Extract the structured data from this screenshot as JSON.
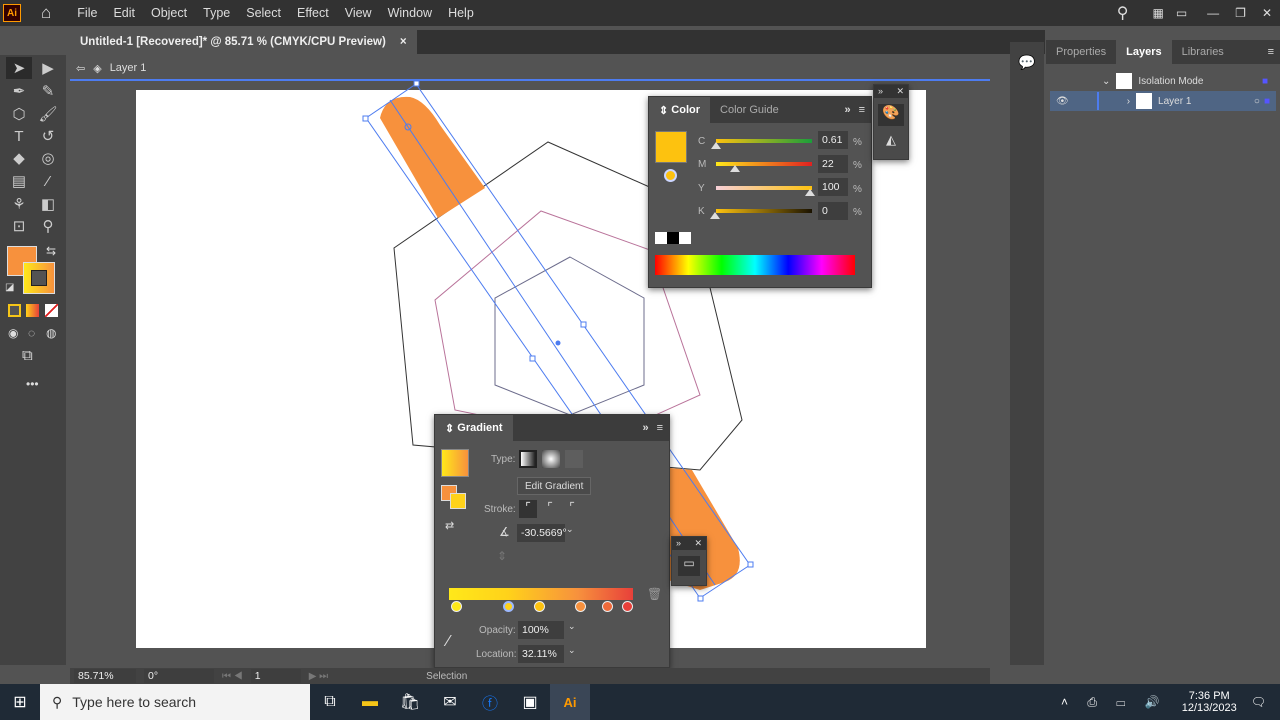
{
  "app": {
    "logo": "Ai",
    "menu": [
      "File",
      "Edit",
      "Object",
      "Type",
      "Select",
      "Effect",
      "View",
      "Window",
      "Help"
    ]
  },
  "document": {
    "tab_title": "Untitled-1 [Recovered]* @ 85.71 % (CMYK/CPU Preview)",
    "close": "×",
    "breadcrumb": "Layer 1"
  },
  "colors": {
    "fill": "#f7913d",
    "stroke_gradient_start": "#ffe81a",
    "stroke_gradient_end": "#e8403a",
    "accent": "#4d7cf0",
    "current_color": "#fdc20f"
  },
  "color_panel": {
    "tabs": [
      "Color",
      "Color Guide"
    ],
    "channels": [
      {
        "label": "C",
        "value": "0.61",
        "unit": "%"
      },
      {
        "label": "M",
        "value": "22",
        "unit": "%"
      },
      {
        "label": "Y",
        "value": "100",
        "unit": "%"
      },
      {
        "label": "K",
        "value": "0",
        "unit": "%"
      }
    ]
  },
  "gradient_panel": {
    "title": "Gradient",
    "type_label": "Type:",
    "edit_button": "Edit Gradient",
    "stroke_label": "Stroke:",
    "angle": "-30.5669°",
    "opacity_label": "Opacity:",
    "opacity": "100%",
    "location_label": "Location:",
    "location": "32.11%",
    "stops": [
      0.02,
      0.11,
      0.17,
      0.25,
      0.31,
      0.35
    ]
  },
  "layers_panel": {
    "tabs": [
      "Properties",
      "Layers",
      "Libraries"
    ],
    "rows": [
      {
        "name": "Isolation Mode"
      },
      {
        "name": "Layer 1"
      }
    ]
  },
  "status": {
    "zoom": "85.71%",
    "rotation": "0°",
    "artboard": "1",
    "tool": "Selection"
  },
  "taskbar": {
    "search_placeholder": "Type here to search",
    "time": "7:36 PM",
    "date": "12/13/2023"
  }
}
